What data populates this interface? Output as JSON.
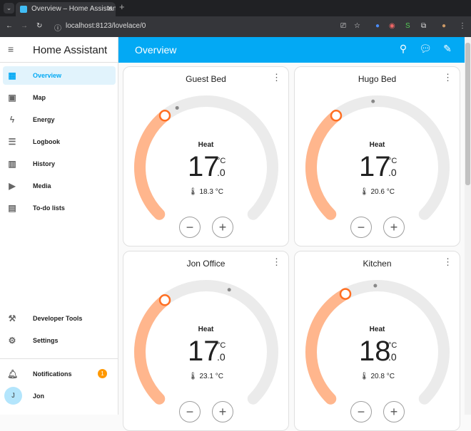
{
  "browser": {
    "tab_title": "Overview – Home Assistant",
    "url": "localhost:8123/lovelace/0"
  },
  "sidebar": {
    "title": "Home Assistant",
    "items": [
      {
        "label": "Overview",
        "icon": "dashboard-icon",
        "active": true
      },
      {
        "label": "Map",
        "icon": "map-icon"
      },
      {
        "label": "Energy",
        "icon": "lightning-icon"
      },
      {
        "label": "Logbook",
        "icon": "list-icon"
      },
      {
        "label": "History",
        "icon": "chart-icon"
      },
      {
        "label": "Media",
        "icon": "media-icon"
      },
      {
        "label": "To-do lists",
        "icon": "clipboard-icon"
      }
    ],
    "bottom": [
      {
        "label": "Developer Tools",
        "icon": "hammer-icon"
      },
      {
        "label": "Settings",
        "icon": "gear-icon"
      }
    ],
    "notifications": {
      "label": "Notifications",
      "count": "1"
    },
    "user": {
      "name": "Jon",
      "initial": "J"
    }
  },
  "header": {
    "title": "Overview"
  },
  "colors": {
    "accent": "#03a9f4",
    "heat": "#ff6f22",
    "heat_arc": "#ffb68d",
    "track": "#ebebeb"
  },
  "thermostat_range": {
    "min": 7,
    "max": 35
  },
  "thermostats": [
    {
      "name": "Guest Bed",
      "mode": "Heat",
      "target": 17.0,
      "target_int": "17",
      "target_dec": ".0",
      "unit": "°C",
      "current": 18.3,
      "current_label": "18.3 °C"
    },
    {
      "name": "Hugo Bed",
      "mode": "Heat",
      "target": 17.0,
      "target_int": "17",
      "target_dec": ".0",
      "unit": "°C",
      "current": 20.6,
      "current_label": "20.6 °C"
    },
    {
      "name": "Jon Office",
      "mode": "Heat",
      "target": 17.0,
      "target_int": "17",
      "target_dec": ".0",
      "unit": "°C",
      "current": 23.1,
      "current_label": "23.1 °C"
    },
    {
      "name": "Kitchen",
      "mode": "Heat",
      "target": 18.0,
      "target_int": "18",
      "target_dec": ".0",
      "unit": "°C",
      "current": 20.8,
      "current_label": "20.8 °C"
    }
  ]
}
